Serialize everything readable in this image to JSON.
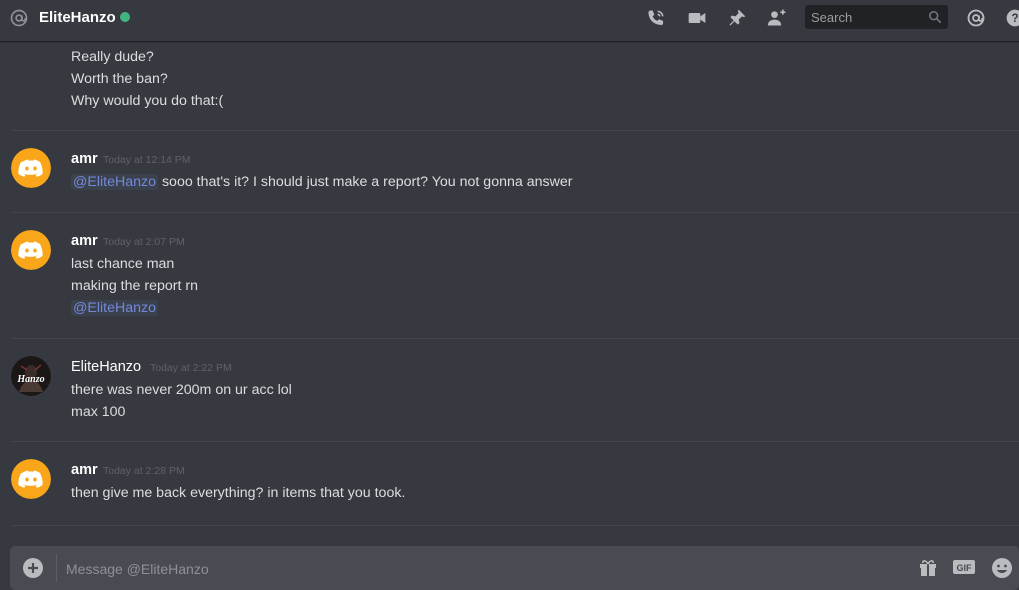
{
  "header": {
    "title": "EliteHanzo",
    "status": "online",
    "search_placeholder": "Search",
    "icons": [
      "at-icon",
      "call-icon",
      "video-icon",
      "pin-icon",
      "add-friend-icon",
      "search-icon",
      "mentions-icon",
      "help-icon"
    ]
  },
  "messages": [
    {
      "continuation": true,
      "lines": [
        "Really dude?",
        "Worth the ban?",
        "Why would you do that:("
      ]
    },
    {
      "author": "amr",
      "timestamp": "Today at 12:14 PM",
      "mention": "@EliteHanzo",
      "line_after_mention": " sooo that's it? I should just make a report? You not gonna answer"
    },
    {
      "author": "amr",
      "timestamp": "Today at 2:07 PM",
      "lines": [
        "last chance man",
        "making the report rn"
      ],
      "mention": "@EliteHanzo"
    },
    {
      "author": "EliteHanzo",
      "timestamp": "Today at 2:22 PM",
      "avatar_text": "Hanzo",
      "lines": [
        "there was never 200m on ur acc lol",
        "max 100"
      ]
    },
    {
      "author": "amr",
      "timestamp": "Today at 2:28 PM",
      "lines": [
        "then give me back everything? in items that you took."
      ]
    }
  ],
  "composer": {
    "placeholder": "Message @EliteHanzo",
    "gif_label": "GIF"
  },
  "colors": {
    "background": "#36393f",
    "accent": "#7289da",
    "online": "#43b581",
    "discord_avatar": "#faa61a"
  }
}
